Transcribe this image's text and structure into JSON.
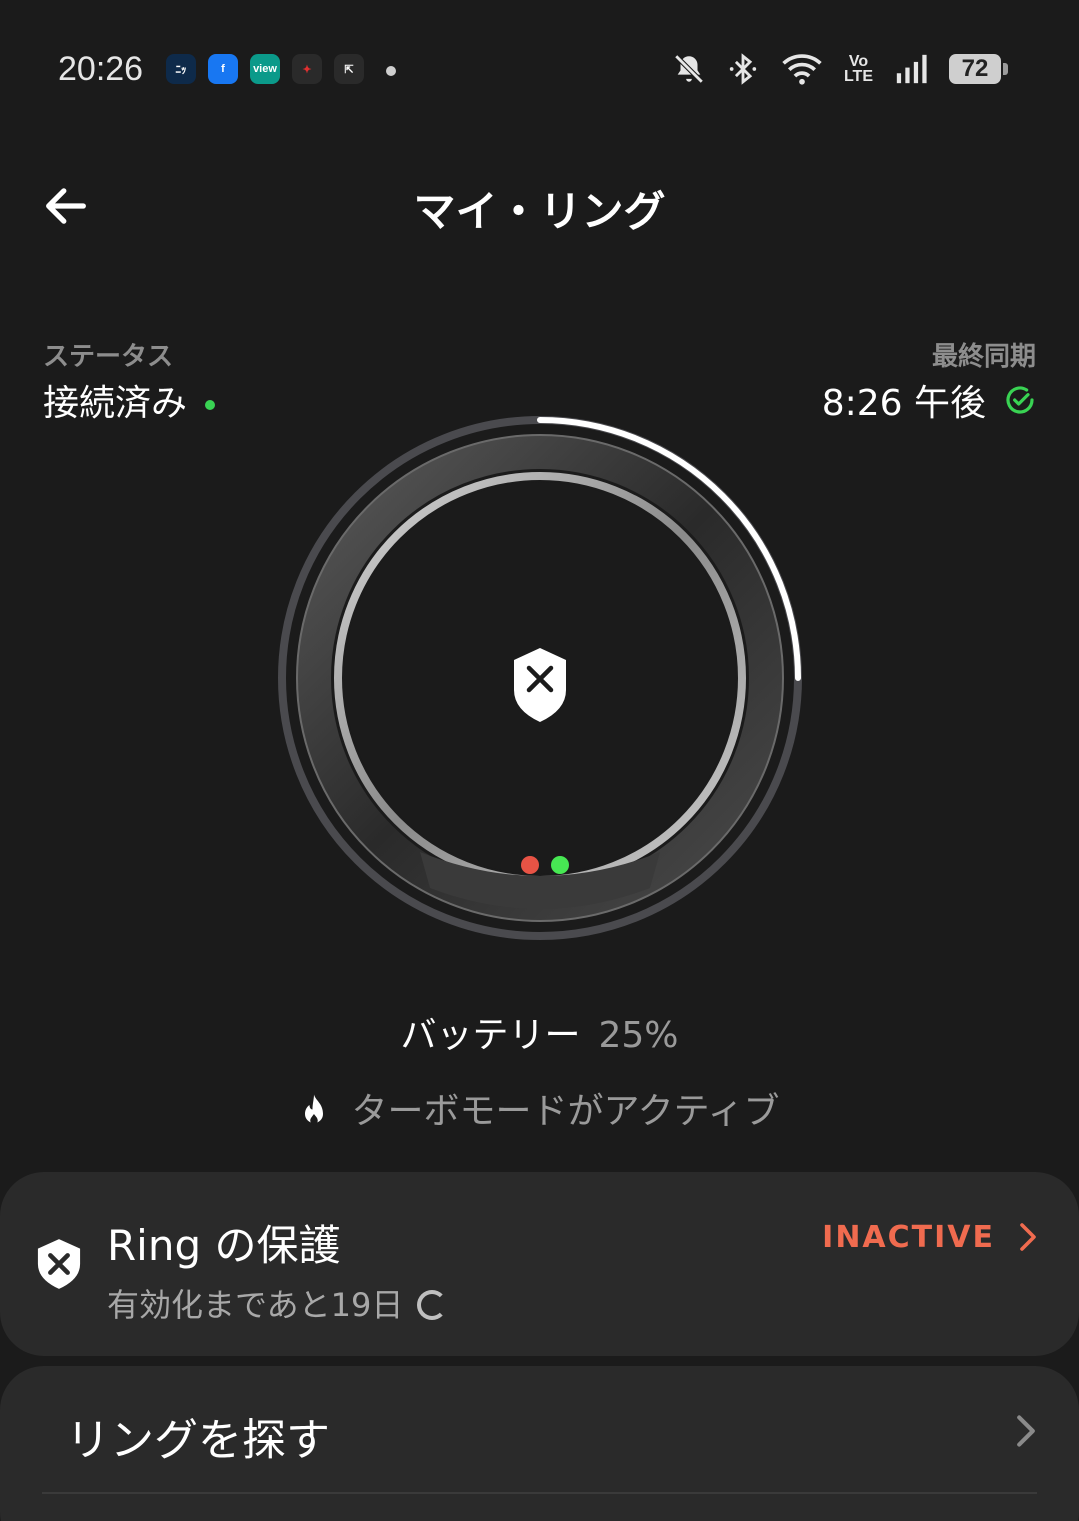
{
  "status_bar": {
    "time": "20:26",
    "apps": [
      {
        "name": "news-app-icon",
        "text": "ﾆｯ",
        "bg": "#0e2a4a",
        "fg": "#ffffff"
      },
      {
        "name": "facebook-app-icon",
        "text": "f",
        "bg": "#1877f2",
        "fg": "#ffffff"
      },
      {
        "name": "view-app-icon",
        "text": "view",
        "bg": "#0b9a8a",
        "fg": "#ffffff"
      },
      {
        "name": "game-app-icon",
        "text": "✦",
        "bg": "#2a2a2a",
        "fg": "#e03030"
      },
      {
        "name": "arrow-app-icon",
        "text": "⇱",
        "bg": "#2a2a2a",
        "fg": "#ffffff"
      }
    ],
    "volte_top": "Vo",
    "volte_bottom": "LTE",
    "battery": "72"
  },
  "header": {
    "title": "マイ・リング"
  },
  "status": {
    "label": "ステータス",
    "value": "接続済み"
  },
  "sync": {
    "label": "最終同期",
    "value": "8:26 午後"
  },
  "ring": {
    "battery_progress": 0.25
  },
  "battery": {
    "label": "バッテリー",
    "value": "25%"
  },
  "turbo": {
    "text": "ターボモードがアクティブ"
  },
  "protection": {
    "title": "Ring の保護",
    "subtitle": "有効化まであと19日",
    "status": "INACTIVE"
  },
  "find": {
    "title": "リングを探す"
  },
  "colors": {
    "background": "#1b1b1b",
    "card": "#2a2a2a",
    "accent_green": "#39d353",
    "inactive_red": "#f06b4f"
  }
}
